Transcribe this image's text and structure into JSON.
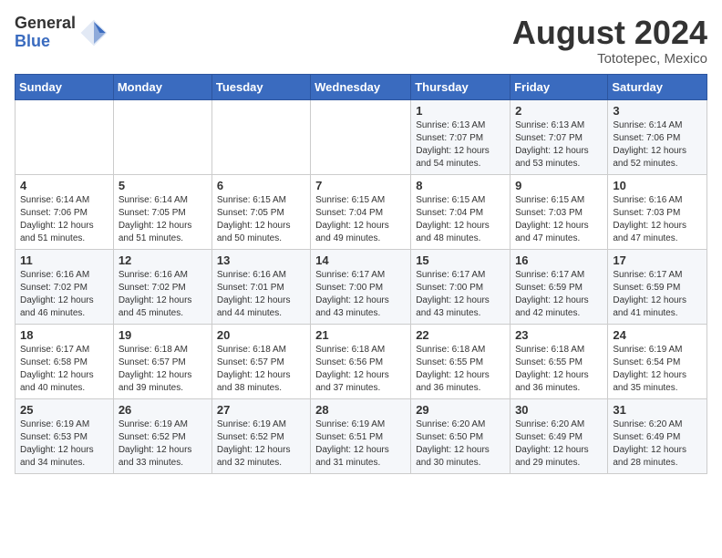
{
  "logo": {
    "general": "General",
    "blue": "Blue"
  },
  "header": {
    "month_year": "August 2024",
    "location": "Tototepec, Mexico"
  },
  "weekdays": [
    "Sunday",
    "Monday",
    "Tuesday",
    "Wednesday",
    "Thursday",
    "Friday",
    "Saturday"
  ],
  "weeks": [
    [
      {
        "day": "",
        "info": ""
      },
      {
        "day": "",
        "info": ""
      },
      {
        "day": "",
        "info": ""
      },
      {
        "day": "",
        "info": ""
      },
      {
        "day": "1",
        "info": "Sunrise: 6:13 AM\nSunset: 7:07 PM\nDaylight: 12 hours\nand 54 minutes."
      },
      {
        "day": "2",
        "info": "Sunrise: 6:13 AM\nSunset: 7:07 PM\nDaylight: 12 hours\nand 53 minutes."
      },
      {
        "day": "3",
        "info": "Sunrise: 6:14 AM\nSunset: 7:06 PM\nDaylight: 12 hours\nand 52 minutes."
      }
    ],
    [
      {
        "day": "4",
        "info": "Sunrise: 6:14 AM\nSunset: 7:06 PM\nDaylight: 12 hours\nand 51 minutes."
      },
      {
        "day": "5",
        "info": "Sunrise: 6:14 AM\nSunset: 7:05 PM\nDaylight: 12 hours\nand 51 minutes."
      },
      {
        "day": "6",
        "info": "Sunrise: 6:15 AM\nSunset: 7:05 PM\nDaylight: 12 hours\nand 50 minutes."
      },
      {
        "day": "7",
        "info": "Sunrise: 6:15 AM\nSunset: 7:04 PM\nDaylight: 12 hours\nand 49 minutes."
      },
      {
        "day": "8",
        "info": "Sunrise: 6:15 AM\nSunset: 7:04 PM\nDaylight: 12 hours\nand 48 minutes."
      },
      {
        "day": "9",
        "info": "Sunrise: 6:15 AM\nSunset: 7:03 PM\nDaylight: 12 hours\nand 47 minutes."
      },
      {
        "day": "10",
        "info": "Sunrise: 6:16 AM\nSunset: 7:03 PM\nDaylight: 12 hours\nand 47 minutes."
      }
    ],
    [
      {
        "day": "11",
        "info": "Sunrise: 6:16 AM\nSunset: 7:02 PM\nDaylight: 12 hours\nand 46 minutes."
      },
      {
        "day": "12",
        "info": "Sunrise: 6:16 AM\nSunset: 7:02 PM\nDaylight: 12 hours\nand 45 minutes."
      },
      {
        "day": "13",
        "info": "Sunrise: 6:16 AM\nSunset: 7:01 PM\nDaylight: 12 hours\nand 44 minutes."
      },
      {
        "day": "14",
        "info": "Sunrise: 6:17 AM\nSunset: 7:00 PM\nDaylight: 12 hours\nand 43 minutes."
      },
      {
        "day": "15",
        "info": "Sunrise: 6:17 AM\nSunset: 7:00 PM\nDaylight: 12 hours\nand 43 minutes."
      },
      {
        "day": "16",
        "info": "Sunrise: 6:17 AM\nSunset: 6:59 PM\nDaylight: 12 hours\nand 42 minutes."
      },
      {
        "day": "17",
        "info": "Sunrise: 6:17 AM\nSunset: 6:59 PM\nDaylight: 12 hours\nand 41 minutes."
      }
    ],
    [
      {
        "day": "18",
        "info": "Sunrise: 6:17 AM\nSunset: 6:58 PM\nDaylight: 12 hours\nand 40 minutes."
      },
      {
        "day": "19",
        "info": "Sunrise: 6:18 AM\nSunset: 6:57 PM\nDaylight: 12 hours\nand 39 minutes."
      },
      {
        "day": "20",
        "info": "Sunrise: 6:18 AM\nSunset: 6:57 PM\nDaylight: 12 hours\nand 38 minutes."
      },
      {
        "day": "21",
        "info": "Sunrise: 6:18 AM\nSunset: 6:56 PM\nDaylight: 12 hours\nand 37 minutes."
      },
      {
        "day": "22",
        "info": "Sunrise: 6:18 AM\nSunset: 6:55 PM\nDaylight: 12 hours\nand 36 minutes."
      },
      {
        "day": "23",
        "info": "Sunrise: 6:18 AM\nSunset: 6:55 PM\nDaylight: 12 hours\nand 36 minutes."
      },
      {
        "day": "24",
        "info": "Sunrise: 6:19 AM\nSunset: 6:54 PM\nDaylight: 12 hours\nand 35 minutes."
      }
    ],
    [
      {
        "day": "25",
        "info": "Sunrise: 6:19 AM\nSunset: 6:53 PM\nDaylight: 12 hours\nand 34 minutes."
      },
      {
        "day": "26",
        "info": "Sunrise: 6:19 AM\nSunset: 6:52 PM\nDaylight: 12 hours\nand 33 minutes."
      },
      {
        "day": "27",
        "info": "Sunrise: 6:19 AM\nSunset: 6:52 PM\nDaylight: 12 hours\nand 32 minutes."
      },
      {
        "day": "28",
        "info": "Sunrise: 6:19 AM\nSunset: 6:51 PM\nDaylight: 12 hours\nand 31 minutes."
      },
      {
        "day": "29",
        "info": "Sunrise: 6:20 AM\nSunset: 6:50 PM\nDaylight: 12 hours\nand 30 minutes."
      },
      {
        "day": "30",
        "info": "Sunrise: 6:20 AM\nSunset: 6:49 PM\nDaylight: 12 hours\nand 29 minutes."
      },
      {
        "day": "31",
        "info": "Sunrise: 6:20 AM\nSunset: 6:49 PM\nDaylight: 12 hours\nand 28 minutes."
      }
    ]
  ]
}
